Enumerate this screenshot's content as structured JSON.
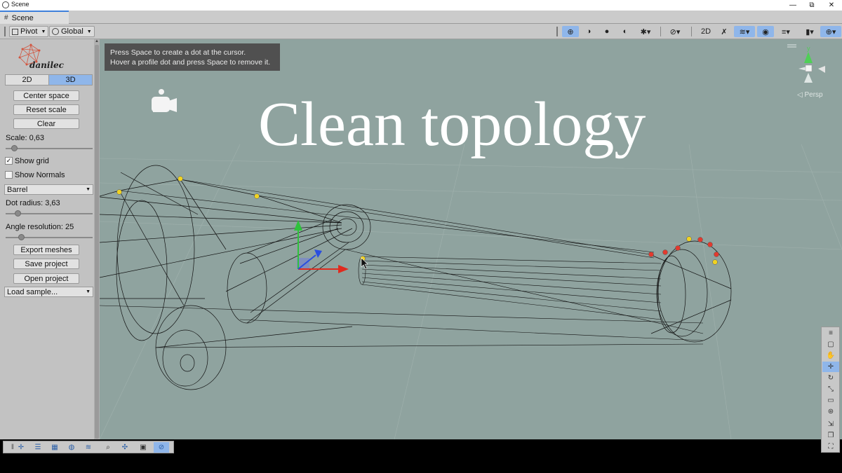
{
  "window": {
    "title": "Scene"
  },
  "tab": {
    "label": "Scene"
  },
  "toolbar": {
    "pivot_label": "Pivot",
    "global_label": "Global",
    "toggle_2d_label": "2D"
  },
  "panel": {
    "logo_text": "danilec",
    "mode_2d": "2D",
    "mode_3d": "3D",
    "center_space": "Center space",
    "reset_scale": "Reset scale",
    "clear": "Clear",
    "scale_label": "Scale: 0,63",
    "scale_value": 0.1,
    "show_grid_label": "Show grid",
    "show_grid_checked": true,
    "show_normals_label": "Show Normals",
    "show_normals_checked": false,
    "shape_selected": "Barrel",
    "dot_radius_label": "Dot radius: 3,63",
    "dot_radius_value": 0.14,
    "angle_resolution_label": "Angle resolution: 25",
    "angle_resolution_value": 0.18,
    "export_meshes": "Export meshes",
    "save_project": "Save project",
    "open_project": "Open project",
    "load_sample": "Load sample..."
  },
  "viewport": {
    "hint_line1": "Press Space to create a dot at the cursor.",
    "hint_line2": "Hover a profile dot and press Space to remove it.",
    "title_text": "Clean topology",
    "persp_label": "◁ Persp",
    "gizmo_y_label": "y",
    "colors": {
      "background": "#8fa39f",
      "wire": "#111111",
      "dot_yellow": "#f1d321",
      "dot_red": "#e23a2e",
      "axis_x": "#e02a1e",
      "axis_y": "#2fc23c",
      "axis_z": "#2a4ee0"
    }
  },
  "icons": {
    "app": "unity-icon",
    "pivot": "pivot-icon",
    "global": "globe-icon",
    "camera": "camera-icon"
  }
}
